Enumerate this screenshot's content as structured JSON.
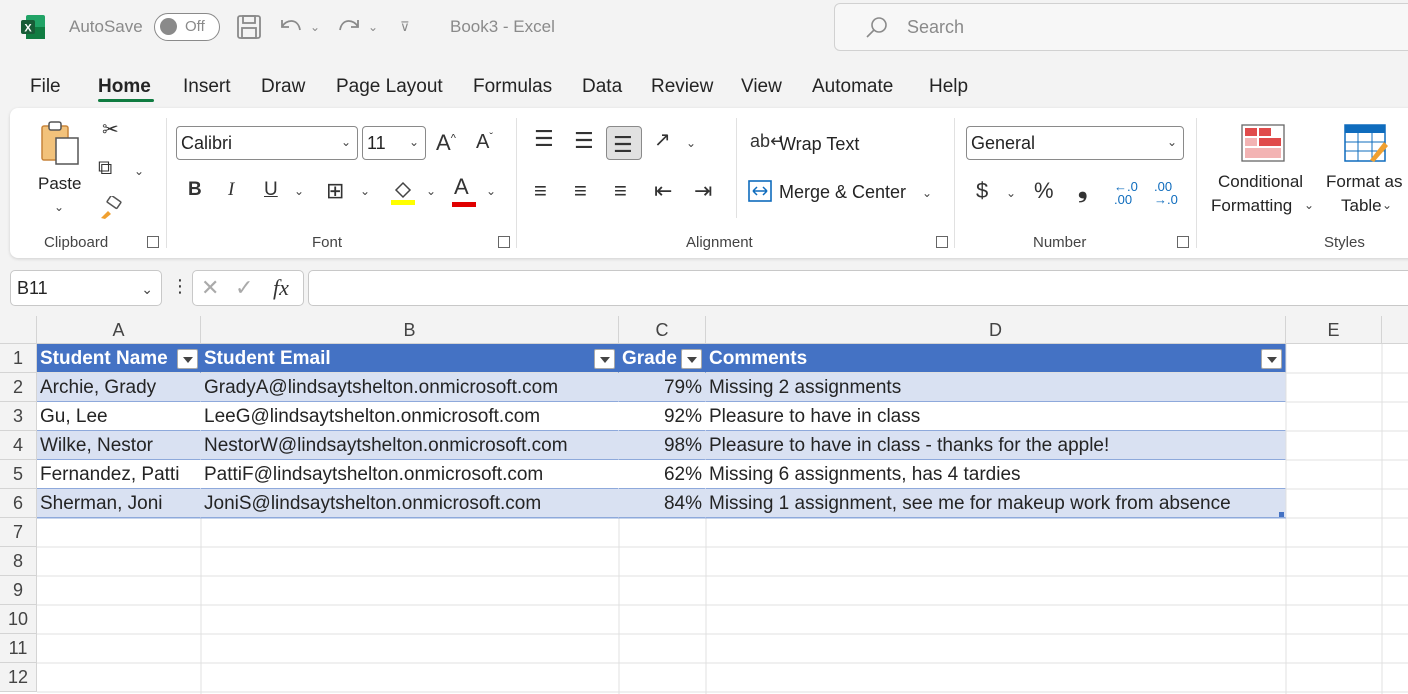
{
  "titlebar": {
    "autosave_label": "AutoSave",
    "autosave_state": "Off",
    "doc_title": "Book3  -  Excel",
    "search_placeholder": "Search"
  },
  "menu": {
    "tabs": [
      "File",
      "Home",
      "Insert",
      "Draw",
      "Page Layout",
      "Formulas",
      "Data",
      "Review",
      "View",
      "Automate",
      "Help"
    ],
    "active": "Home"
  },
  "ribbon": {
    "clipboard": {
      "paste_label": "Paste",
      "group_label": "Clipboard"
    },
    "font": {
      "family": "Calibri",
      "size": "11",
      "group_label": "Font",
      "bold": "B",
      "italic": "I",
      "underline": "U",
      "grow": "A",
      "shrink": "A",
      "font_color_glyph": "A"
    },
    "alignment": {
      "wrap_text": "Wrap Text",
      "merge_center": "Merge & Center",
      "group_label": "Alignment"
    },
    "number": {
      "format": "General",
      "currency": "$",
      "percent": "%",
      "comma": "❟",
      "group_label": "Number"
    },
    "styles": {
      "conditional_line1": "Conditional",
      "conditional_line2": "Formatting",
      "format_table_line1": "Format as",
      "format_table_line2": "Table",
      "group_label": "Styles"
    }
  },
  "formula_bar": {
    "name_box": "B11",
    "fx": "fx",
    "formula": ""
  },
  "colors": {
    "accent": "#107c41",
    "table_header": "#4472c4",
    "band": "#d9e1f2",
    "excel_green": "#185c37"
  },
  "sheet": {
    "columns": [
      "A",
      "B",
      "C",
      "D",
      "E"
    ],
    "rows": [
      "1",
      "2",
      "3",
      "4",
      "5",
      "6",
      "7",
      "8",
      "9",
      "10",
      "11",
      "12"
    ],
    "table_headers": [
      "Student Name",
      "Student Email",
      "Grade",
      "Comments"
    ],
    "table_rows": [
      [
        "Archie, Grady",
        "GradyA@lindsaytshelton.onmicrosoft.com",
        "79%",
        "Missing 2 assignments"
      ],
      [
        "Gu, Lee",
        "LeeG@lindsaytshelton.onmicrosoft.com",
        "92%",
        "Pleasure to have in class"
      ],
      [
        "Wilke, Nestor",
        "NestorW@lindsaytshelton.onmicrosoft.com",
        "98%",
        "Pleasure to have in class - thanks for the apple!"
      ],
      [
        "Fernandez, Patti",
        "PattiF@lindsaytshelton.onmicrosoft.com",
        "62%",
        "Missing 6 assignments, has 4 tardies"
      ],
      [
        "Sherman, Joni",
        "JoniS@lindsaytshelton.onmicrosoft.com",
        "84%",
        "Missing 1 assignment, see me for makeup work from absence"
      ]
    ]
  }
}
